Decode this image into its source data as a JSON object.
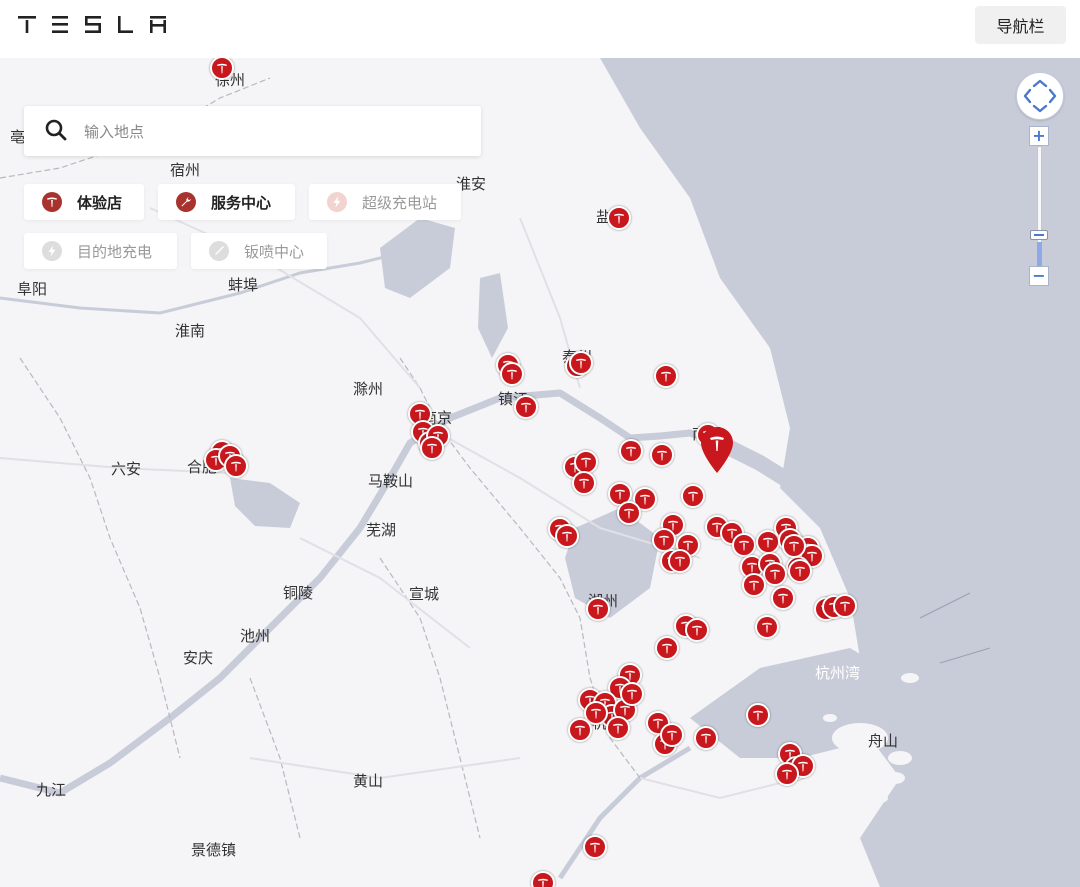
{
  "header": {
    "brand": "TESLA",
    "nav_label": "导航栏"
  },
  "search": {
    "placeholder": "输入地点"
  },
  "filters": [
    {
      "label": "体验店",
      "active": true,
      "icon": "tesla-logo-icon"
    },
    {
      "label": "服务中心",
      "active": true,
      "icon": "wrench-icon"
    },
    {
      "label": "超级充电站",
      "active": false,
      "icon": "lightning-icon"
    },
    {
      "label": "目的地充电",
      "active": false,
      "icon": "lightning-icon"
    },
    {
      "label": "钣喷中心",
      "active": false,
      "icon": "spray-gun-icon"
    }
  ],
  "map": {
    "cities": [
      "宿州",
      "淮安",
      "阜阳",
      "蚌埠",
      "淮南",
      "滁州",
      "六安",
      "合肥",
      "马鞍山",
      "芜湖",
      "铜陵",
      "宣城",
      "池州",
      "安庆",
      "黄山",
      "九江",
      "景德镇",
      "舟山",
      "亳",
      "徐州",
      "盐",
      "泰州",
      "镇江",
      "南京",
      "南通",
      "湖州",
      "杭州"
    ],
    "water_labels": [
      "杭州湾"
    ],
    "colors": {
      "pin": "#c8171d",
      "land": "#f5f5f7",
      "sea": "#c8ccd9",
      "water": "#c8ccd9"
    },
    "selected_pin_icon": "map-marker-icon"
  },
  "zoom": {
    "in_label": "+",
    "out_label": "−",
    "pan_icon": "pan-compass-icon"
  }
}
